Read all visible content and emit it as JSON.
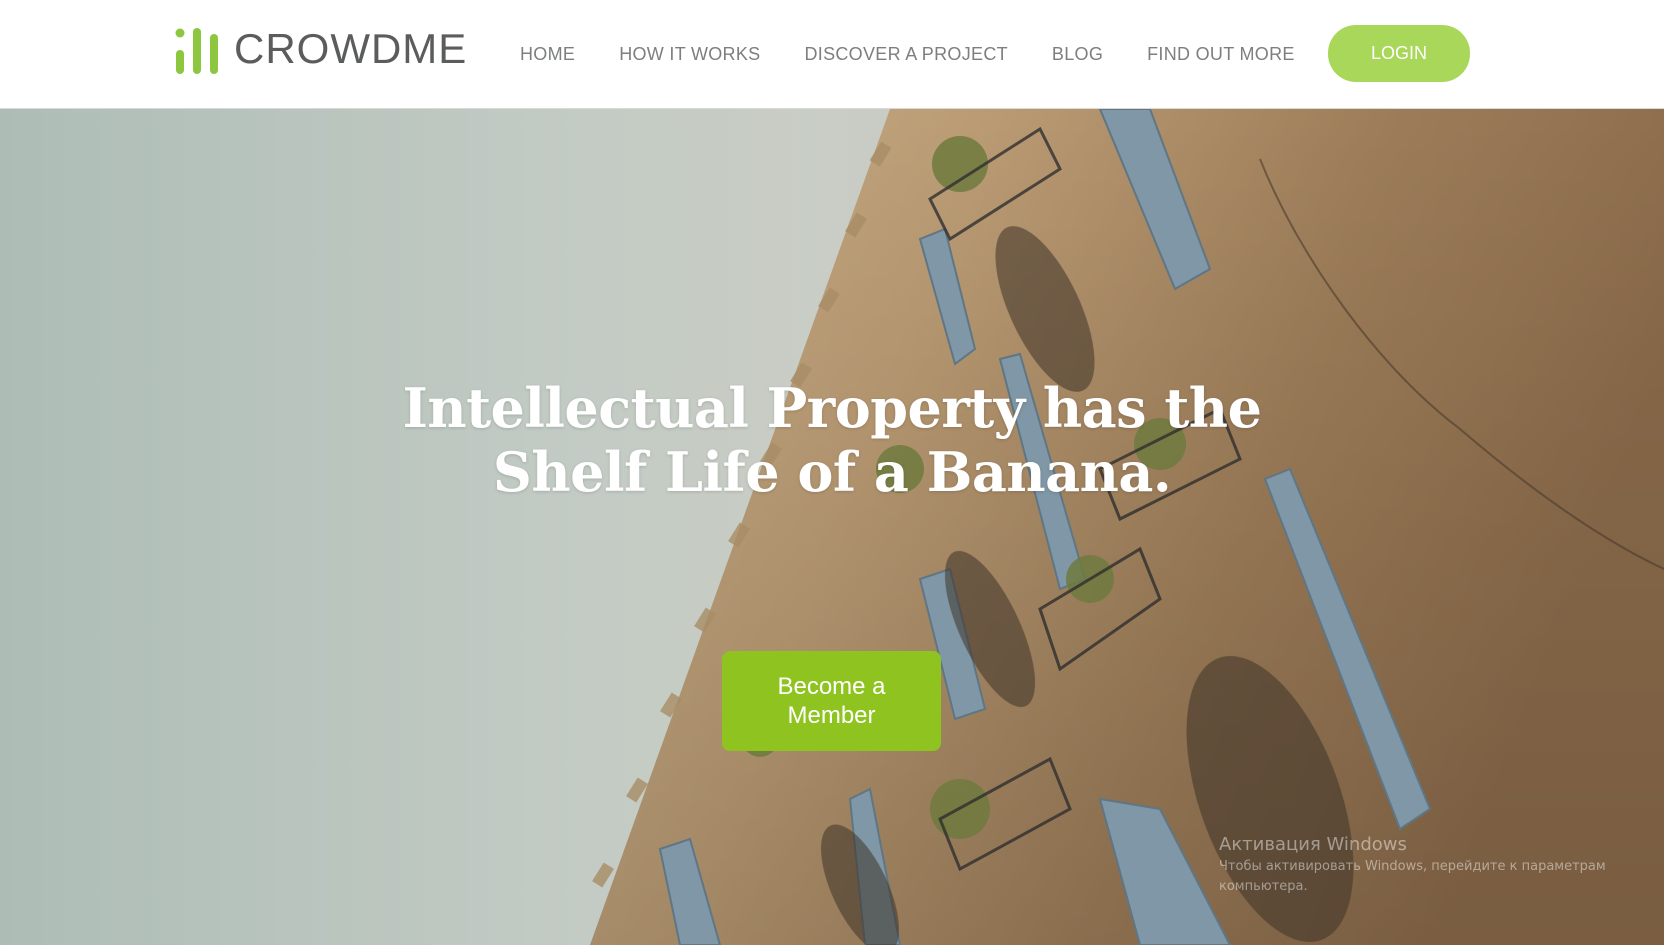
{
  "brand": {
    "name": "CROWDME",
    "logo_icon": "bar-chart-logo-icon",
    "accent_color": "#8dc63f"
  },
  "nav": {
    "items": [
      {
        "label": "HOME"
      },
      {
        "label": "HOW IT WORKS"
      },
      {
        "label": "DISCOVER A PROJECT"
      },
      {
        "label": "BLOG"
      },
      {
        "label": "FIND OUT MORE"
      }
    ],
    "login_label": "LOGIN",
    "login_color": "#a8d75a"
  },
  "hero": {
    "title_line1": "Intellectual Property has the",
    "title_line2": "Shelf Life of a Banana.",
    "cta_label": "Become a Member",
    "cta_color": "#8fc31f"
  },
  "watermark": {
    "title": "Активация Windows",
    "line1": "Чтобы активировать Windows, перейдите к параметрам",
    "line2": "компьютера."
  }
}
